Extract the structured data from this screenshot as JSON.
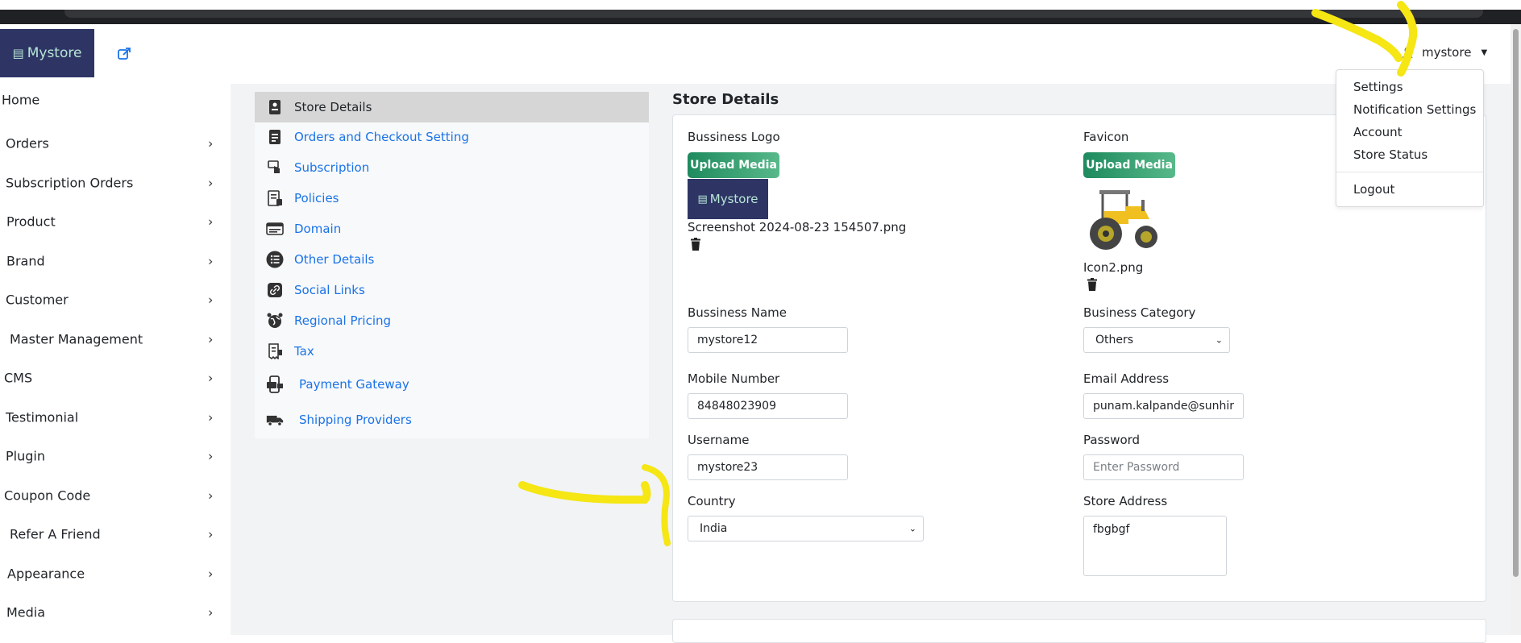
{
  "app": {
    "logo_text": "Mystore",
    "user_name": "mystore"
  },
  "user_dropdown": {
    "items": [
      "Settings",
      "Notification Settings",
      "Account",
      "Store Status"
    ],
    "logout": "Logout"
  },
  "sidebar": {
    "home": "Home",
    "items": [
      "Orders",
      "Subscription Orders",
      "Product",
      "Brand",
      "Customer",
      "Master Management",
      "CMS",
      "Testimonial",
      "Plugin",
      "Coupon Code",
      "Refer A Friend",
      "Appearance",
      "Media"
    ]
  },
  "settings_nav": {
    "items": [
      "Store Details",
      "Orders and Checkout Setting",
      "Subscription",
      "Policies",
      "Domain",
      "Other Details",
      "Social Links",
      "Regional Pricing",
      "Tax",
      "Payment Gateway",
      "Shipping Providers"
    ]
  },
  "store_details": {
    "title": "Store Details",
    "business_logo_label": "Bussiness Logo",
    "favicon_label": "Favicon",
    "upload_label": "Upload Media",
    "logo_thumb_text": "Mystore",
    "logo_filename": "Screenshot 2024-08-23 154507.png",
    "favicon_filename": "Icon2.png",
    "business_name_label": "Bussiness Name",
    "business_name_value": "mystore12",
    "business_category_label": "Business Category",
    "business_category_value": "Others",
    "mobile_label": "Mobile Number",
    "mobile_value": "84848023909",
    "email_label": "Email Address",
    "email_value": "punam.kalpande@sunhir",
    "username_label": "Username",
    "username_value": "mystore23",
    "password_label": "Password",
    "password_placeholder": "Enter Password",
    "country_label": "Country",
    "country_value": "India",
    "address_label": "Store Address",
    "address_value": "fbgbgf"
  },
  "colors": {
    "logo_bg": "#2e3565",
    "link": "#1a73e8",
    "upload_button": "#1e8a5e",
    "annotation": "#f5e614"
  }
}
